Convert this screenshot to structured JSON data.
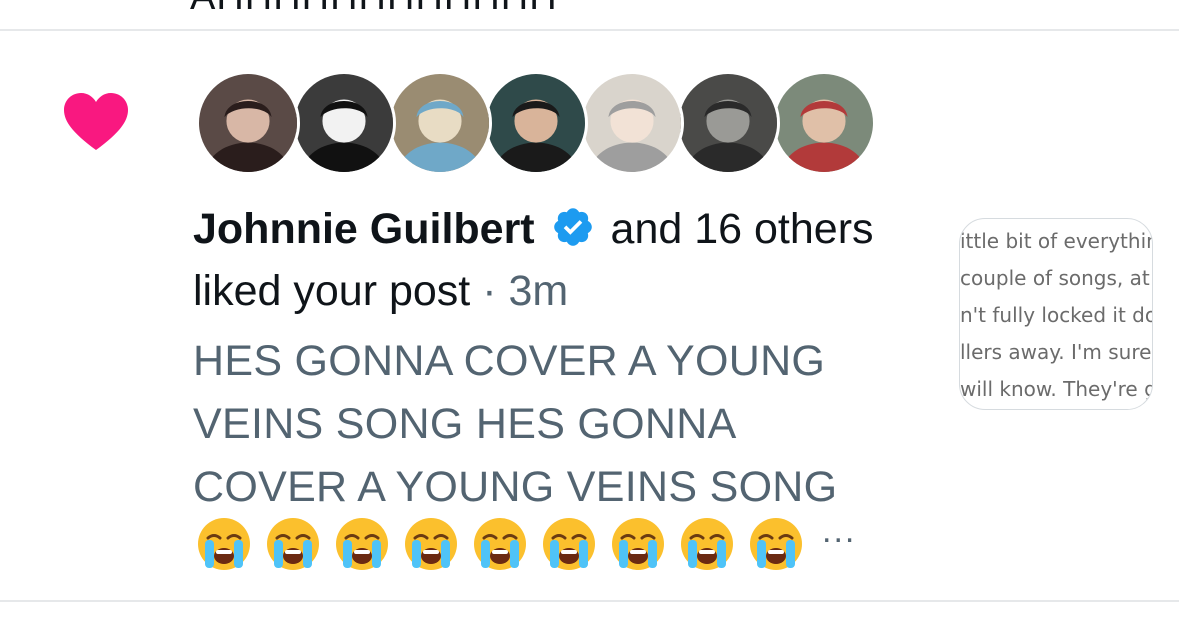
{
  "previous_item": {
    "remnant_text": "AHHHHHHHHHHHH"
  },
  "notification": {
    "type_icon": "heart-icon",
    "accent_color": "#f91880",
    "avatars": [
      {
        "name": "avatar-1",
        "bg": "#5a4a46",
        "fg": "#2a1d1c",
        "face": "#d8b7a6"
      },
      {
        "name": "avatar-2",
        "bg": "#3b3b3b",
        "fg": "#111111",
        "face": "#f2f2f2"
      },
      {
        "name": "avatar-3",
        "bg": "#9a8c72",
        "fg": "#6fa8c8",
        "face": "#e8dcc4"
      },
      {
        "name": "avatar-4",
        "bg": "#2f4a4a",
        "fg": "#1a1a1a",
        "face": "#d9b49a"
      },
      {
        "name": "avatar-5",
        "bg": "#d9d4cc",
        "fg": "#9e9e9e",
        "face": "#f2e2d6"
      },
      {
        "name": "avatar-6",
        "bg": "#4a4a48",
        "fg": "#2a2a2a",
        "face": "#9a9a96"
      },
      {
        "name": "avatar-7",
        "bg": "#7c8a7a",
        "fg": "#b23a3a",
        "face": "#e0c0a8"
      }
    ],
    "actor_name": "Johnnie Guilbert",
    "verified_icon": "verified-badge-icon",
    "verified_color": "#1d9bf0",
    "action_text": " and 16 others liked your post",
    "separator": " · ",
    "timestamp": "3m",
    "post_text": "HES GONNA COVER A YOUNG VEINS SONG HES GONNA COVER A YOUNG VEINS SONG",
    "emoji_name": "loudly-crying-face-icon",
    "emoji_count": 9,
    "ellipsis": "...",
    "preview_lines": [
      "ittle bit of everythin",
      "couple of songs, at",
      "n't fully locked it do",
      "llers away. I'm sure",
      "will know. They're g"
    ]
  }
}
